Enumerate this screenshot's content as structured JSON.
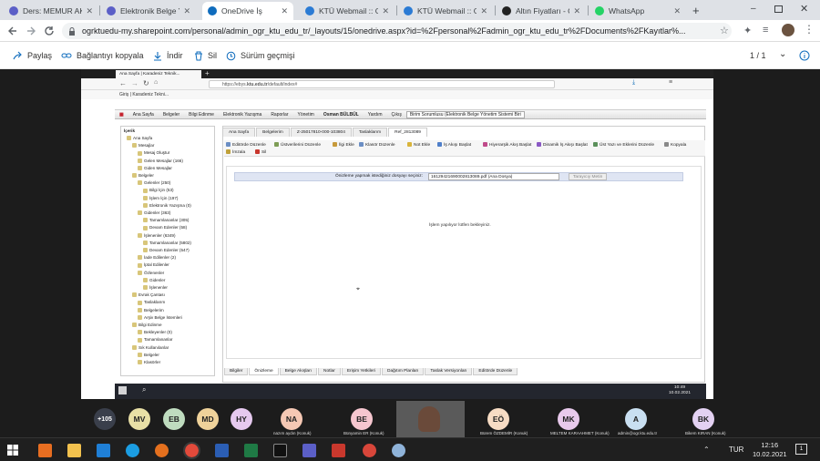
{
  "host_tabs": [
    {
      "title": "Ders: MEMUR AK...",
      "icon": "teams-icon",
      "color": "#5b5fc7"
    },
    {
      "title": "Elektronik Belge Y...",
      "icon": "teams-icon",
      "color": "#5b5fc7"
    },
    {
      "title": "OneDrive İş",
      "icon": "onedrive-icon",
      "color": "#0f6cbd",
      "active": true
    },
    {
      "title": "KTÜ Webmail :: Ge...",
      "icon": "webmail-icon",
      "color": "#2b7bd4"
    },
    {
      "title": "KTÜ Webmail :: Ge...",
      "icon": "webmail-icon",
      "color": "#2b7bd4"
    },
    {
      "title": "Altın Fiyatları - Ca...",
      "icon": "bing-icon",
      "color": "#222222"
    },
    {
      "title": "WhatsApp",
      "icon": "whatsapp-icon",
      "color": "#25d366"
    }
  ],
  "host_address": "ogrktuedu-my.sharepoint.com/personal/admin_ogr_ktu_edu_tr/_layouts/15/onedrive.aspx?id=%2Fpersonal%2Fadmin_ogr_ktu_edu_tr%2FDocuments%2FKayıtlar%...",
  "onedrive_bar": {
    "share": "Paylaş",
    "copy_link": "Bağlantıyı kopyala",
    "download": "İndir",
    "delete": "Sil",
    "version_history": "Sürüm geçmişi",
    "page_counter": "1 / 1"
  },
  "remote": {
    "tab_title": "Ana Sayfa | Karadeniz Teknik...",
    "url_prefix": "https://ebys.",
    "url_domain": "ktu.edu.tr",
    "url_path": "/default/index#",
    "bookmark": "Giriş | Karadeniz Tekni...",
    "menu": [
      "Ana Sayfa",
      "Belgeler",
      "Bilgi Edinme",
      "Elektronik Yazışma",
      "Raporlar",
      "Yönetim"
    ],
    "user_name": "Osman BÜLBÜL",
    "help": "Yardım",
    "logout": "Çıkış",
    "role": "Birim Sorumlusu (Elektronik Belge Yönetim Sistemi Biri",
    "tree_header": "İçerik",
    "tree": [
      {
        "label": "Ana Sayfa",
        "indent": 0
      },
      {
        "label": "Mesajlar",
        "indent": 1
      },
      {
        "label": "Mesaj Oluştur",
        "indent": 2
      },
      {
        "label": "Gelen Mesajlar (166)",
        "indent": 2
      },
      {
        "label": "Giden Mesajlar",
        "indent": 2
      },
      {
        "label": "Belgeler",
        "indent": 1
      },
      {
        "label": "Gelenler (250)",
        "indent": 2
      },
      {
        "label": "Bilgi İçin (53)",
        "indent": 3
      },
      {
        "label": "İşlem İçin (197)",
        "indent": 3
      },
      {
        "label": "Elektronik Yazışma (0)",
        "indent": 3
      },
      {
        "label": "Gidenler (363)",
        "indent": 2
      },
      {
        "label": "Tamamlananlar (305)",
        "indent": 3
      },
      {
        "label": "Devam Edenler (58)",
        "indent": 3
      },
      {
        "label": "İşlenenler (6349)",
        "indent": 2
      },
      {
        "label": "Tamamlananlar (5802)",
        "indent": 3
      },
      {
        "label": "Devam Edenler (547)",
        "indent": 3
      },
      {
        "label": "İade Edilenler (2)",
        "indent": 2
      },
      {
        "label": "İptal Edilenler",
        "indent": 2
      },
      {
        "label": "Özlenenler",
        "indent": 2
      },
      {
        "label": "Gidenler",
        "indent": 3
      },
      {
        "label": "İşlenenler",
        "indent": 3
      },
      {
        "label": "Evrak Çantası",
        "indent": 1
      },
      {
        "label": "Taslaklarım",
        "indent": 2
      },
      {
        "label": "Belgelerim",
        "indent": 2
      },
      {
        "label": "Arşiv Belge İstemleri",
        "indent": 2
      },
      {
        "label": "Bilgi Edinme",
        "indent": 1
      },
      {
        "label": "Bekleyenler (0)",
        "indent": 2
      },
      {
        "label": "Tamamlananlar",
        "indent": 2
      },
      {
        "label": "Sık Kullanılanlar",
        "indent": 1
      },
      {
        "label": "Belgeler",
        "indent": 2
      },
      {
        "label": "Klasörler",
        "indent": 2
      }
    ],
    "doc_tabs": [
      "Ana Sayfa",
      "Belgelerim",
      "Z-25017810-000-103804",
      "Taslaklarım",
      "Ref_2813089"
    ],
    "toolbar": [
      "Editörde Düzenle",
      "Üstverilerini Düzenle",
      "İlgi Ekle",
      "Klasör Düzenle",
      "Not Ekle",
      "İş Akışı Başlat",
      "Hiyerarşik Akış Başlat",
      "Dinamik İş Akışı Başlat",
      "Üst Yazı ve Eklerini Düzenle",
      "Kopyala",
      "İmzala",
      "Sil"
    ],
    "preview_prompt": "Önizleme yapmak istediğiniz dosyayı seçiniz:",
    "selected_file": "16129421690002813089.pdf (Ana Dosya)",
    "preview_button": "Tarayıcıy Metin",
    "processing_text": "İşlem yapılıyor lütfen bekleyiniz.",
    "bottom_tabs": [
      "Bilgiler",
      "Önizleme",
      "Belge Akışları",
      "Notlar",
      "Erişim Yetkileri",
      "Dağıtım Planları",
      "Taslak Versiyonları",
      "Editörde Düzenle"
    ],
    "clock_time": "10:49",
    "clock_date": "10.02.2021"
  },
  "participants": {
    "overflow": "+105",
    "people": [
      {
        "initials": "MV",
        "color": "#e9e0a6",
        "name": ""
      },
      {
        "initials": "EB",
        "color": "#bfdcbf",
        "name": ""
      },
      {
        "initials": "MD",
        "color": "#efd29a",
        "name": ""
      },
      {
        "initials": "HY",
        "color": "#e6c9ef",
        "name": ""
      },
      {
        "initials": "NA",
        "color": "#f5c8b4",
        "name": "nazım aydın (Konuk)"
      },
      {
        "initials": "BE",
        "color": "#f6c6cf",
        "name": "Bünyamin ER (Konuk)"
      },
      {
        "initials": "EÖ",
        "color": "#f7dcc4",
        "name": "Bürem ÖZDEMİR (Konuk)"
      },
      {
        "initials": "MK",
        "color": "#e8c9ec",
        "name": "MELTEM KARAAHMET (Konuk)"
      },
      {
        "initials": "A",
        "color": "#c9dff1",
        "name": "admin@ogr.ktu.edu.tr"
      },
      {
        "initials": "BK",
        "color": "#e3d1f2",
        "name": "Bikem KIRAN (Konuk)"
      }
    ]
  },
  "taskbar": {
    "lang": "TUR",
    "time": "12:16",
    "date": "10.02.2021",
    "notifications": "1"
  }
}
